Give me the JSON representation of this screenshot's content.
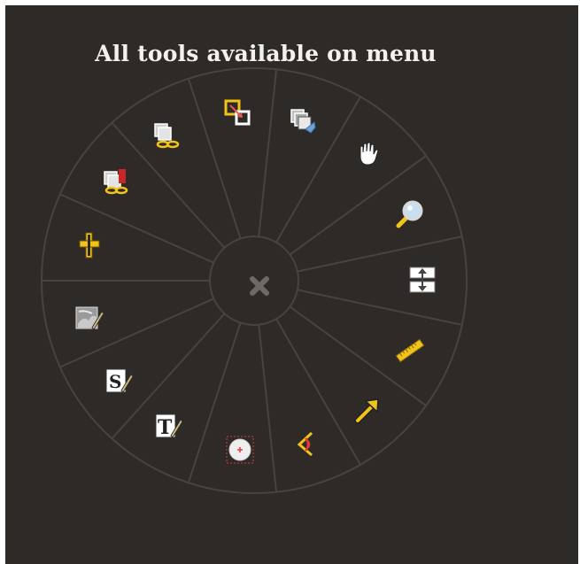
{
  "menu": {
    "title": "All tools available on menu",
    "colors": {
      "background": "#2d2a27",
      "ring_line": "#47433e",
      "accent_yellow": "#f2c31b",
      "close_x": "#6d6a66"
    },
    "tools": [
      {
        "icon": "zoom-area-icon"
      },
      {
        "icon": "copy-layers-icon"
      },
      {
        "icon": "pan-hand-icon"
      },
      {
        "icon": "magnifier-icon"
      },
      {
        "icon": "scroll-vertical-icon"
      },
      {
        "icon": "ruler-icon"
      },
      {
        "icon": "arrow-annotation-icon"
      },
      {
        "icon": "angle-measure-icon"
      },
      {
        "icon": "ellipse-roi-icon"
      },
      {
        "icon": "text-annotation-icon"
      },
      {
        "icon": "series-annotation-icon"
      },
      {
        "icon": "image-annotation-icon"
      },
      {
        "icon": "crosshair-icon"
      },
      {
        "icon": "link-series-icon"
      },
      {
        "icon": "link-layers-icon"
      }
    ],
    "close": {
      "icon": "close-icon"
    }
  }
}
